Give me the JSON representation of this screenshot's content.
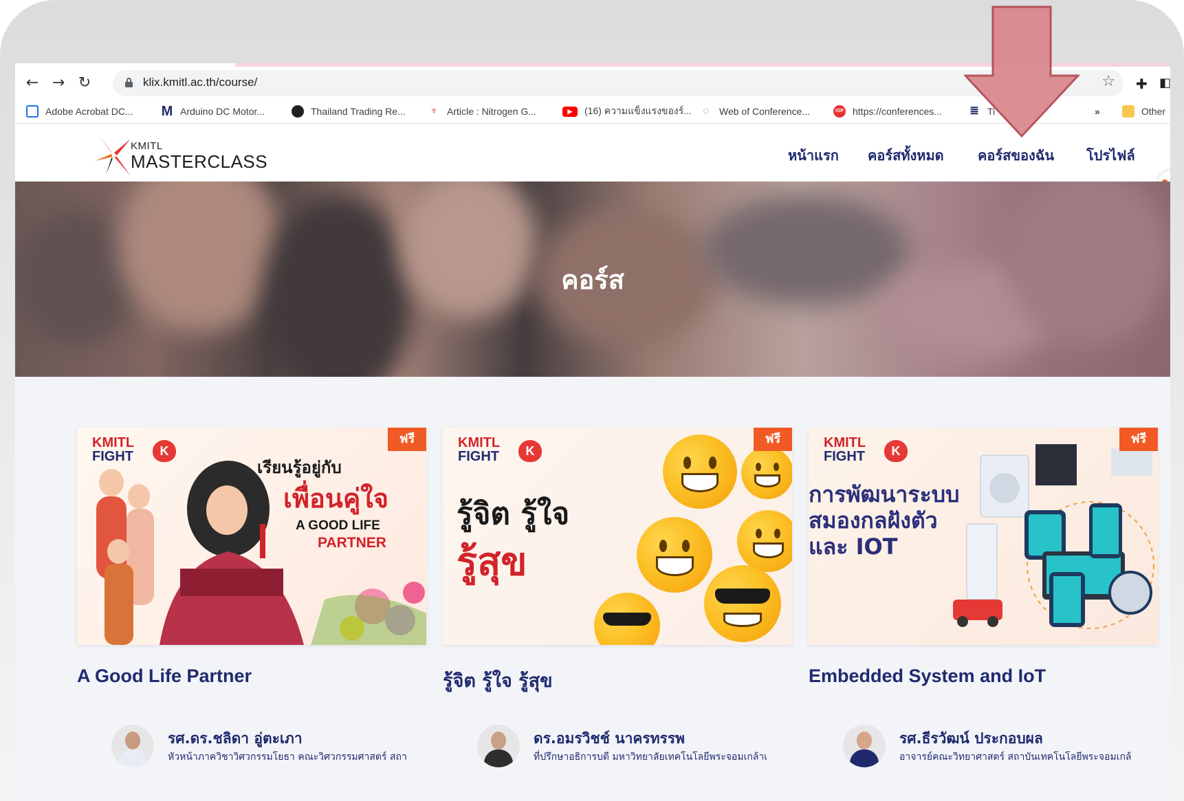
{
  "browser": {
    "url": "klix.kmitl.ac.th/course/",
    "bookmarks": [
      {
        "label": "Adobe Acrobat DC...",
        "icon": "acrobat-icon",
        "color": "#1a73e8"
      },
      {
        "label": "Arduino DC Motor...",
        "icon": "gmail-icon",
        "color": "#1f2a6e"
      },
      {
        "label": "Thailand Trading Re...",
        "icon": "globe-icon",
        "color": "#202124"
      },
      {
        "label": "Article : Nitrogen G...",
        "icon": "tower-icon",
        "color": "#d93025"
      },
      {
        "label": "(16) ความแข็งแรงของร์...",
        "icon": "youtube-icon",
        "color": "#ff0000"
      },
      {
        "label": "Web of Conference...",
        "icon": "wave-icon",
        "color": "#5f6368"
      },
      {
        "label": "https://conferences...",
        "icon": "iop-icon",
        "color": "#e8312f"
      },
      {
        "label": "»",
        "icon": "",
        "color": ""
      },
      {
        "label": "Other",
        "icon": "folder-icon",
        "color": "#f9c74f"
      }
    ]
  },
  "site": {
    "logo_top": "KMITL",
    "logo_bottom": "MASTERCLASS",
    "menu": [
      "หน้าแรก",
      "คอร์สทั้งหมด",
      "คอร์สของฉัน",
      "โปรไฟล์"
    ]
  },
  "hero": {
    "title": "คอร์ส"
  },
  "courses": [
    {
      "badge": "ฟรี",
      "title": "A Good Life Partner",
      "thumb_lines": [
        "เรียนรู้อยู่กับ",
        "เพื่อนคู่ใจ",
        "A GOOD LIFE",
        "PARTNER"
      ],
      "instructor": "รศ.ดร.ชลิดา อู่ตะเภา",
      "role": "หัวหน้าภาควิชาวิศวกรรมโยธา คณะวิศวกรรมศาสตร์ สถา"
    },
    {
      "badge": "ฟรี",
      "title": "รู้จิต รู้ใจ รู้สุข",
      "thumb_lines": [
        "รู้จิต รู้ใจ",
        "รู้สุข"
      ],
      "instructor": "ดร.อมรวิชช์ นาครทรรพ",
      "role": "ที่ปรึกษาอธิการบดี มหาวิทยาลัยเทคโนโลยีพระจอมเกล้าเ"
    },
    {
      "badge": "ฟรี",
      "title": "Embedded System and IoT",
      "thumb_lines": [
        "การพัฒนาระบบ",
        "สมองกลฝังตัว",
        "และ IOT"
      ],
      "instructor": "รศ.ธีรวัฒน์ ประกอบผล",
      "role": "อาจารย์คณะวิทยาศาสตร์ สถาบันเทคโนโลยีพระจอมเกล้"
    }
  ],
  "kmitl_fight": {
    "line1": "KMITL",
    "line2": "FIGHT",
    "heart_letter": "K"
  },
  "colors": {
    "brand_navy": "#1f2a6e",
    "badge_orange": "#f15a24",
    "arrow_fill": "#d9848a",
    "arrow_stroke": "#b0444e"
  }
}
